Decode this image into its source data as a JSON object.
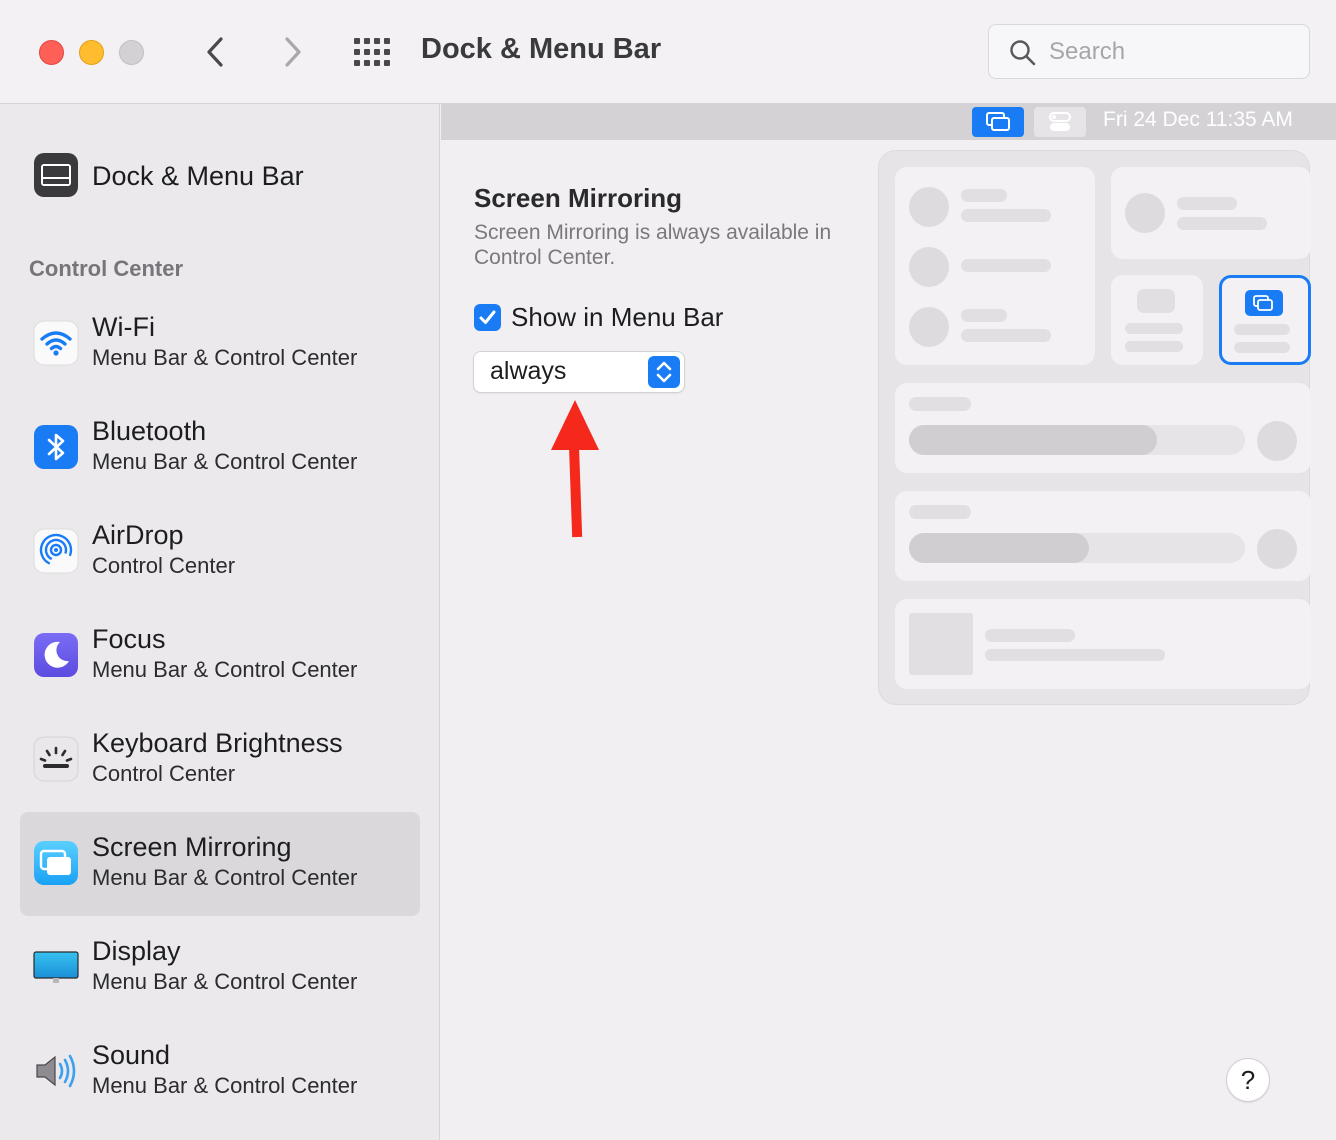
{
  "window": {
    "title": "Dock & Menu Bar",
    "search_placeholder": "Search"
  },
  "sidebar": {
    "top_item": {
      "label": "Dock & Menu Bar",
      "icon": "dock-menubar-icon"
    },
    "section_label": "Control Center",
    "items": [
      {
        "title": "Wi-Fi",
        "subtitle": "Menu Bar & Control Center",
        "icon": "wifi-icon"
      },
      {
        "title": "Bluetooth",
        "subtitle": "Menu Bar & Control Center",
        "icon": "bluetooth-icon"
      },
      {
        "title": "AirDrop",
        "subtitle": "Control Center",
        "icon": "airdrop-icon"
      },
      {
        "title": "Focus",
        "subtitle": "Menu Bar & Control Center",
        "icon": "moon-icon"
      },
      {
        "title": "Keyboard Brightness",
        "subtitle": "Control Center",
        "icon": "keyboard-brightness-icon"
      },
      {
        "title": "Screen Mirroring",
        "subtitle": "Menu Bar & Control Center",
        "icon": "screen-mirroring-icon",
        "selected": true
      },
      {
        "title": "Display",
        "subtitle": "Menu Bar & Control Center",
        "icon": "display-icon"
      },
      {
        "title": "Sound",
        "subtitle": "Menu Bar & Control Center",
        "icon": "speaker-icon"
      }
    ]
  },
  "menubar_preview": {
    "clock": "Fri 24 Dec  11:35 AM"
  },
  "main": {
    "section_title": "Screen Mirroring",
    "description": "Screen Mirroring is always available in Control Center.",
    "show_in_menu_bar_label": "Show in Menu Bar",
    "show_in_menu_bar_checked": true,
    "menu_bar_mode_value": "always",
    "help_label": "?"
  },
  "colors": {
    "accent": "#1a7cf5",
    "annotation_arrow": "#f5281c",
    "close": "#fe5f57",
    "minimize": "#febc2e"
  }
}
